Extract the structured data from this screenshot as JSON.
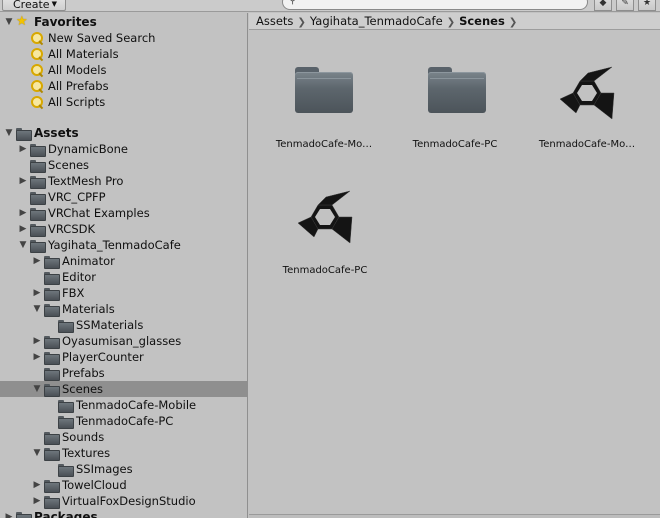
{
  "toolbar": {
    "create_label": "Create",
    "search_value": "",
    "icons": [
      "search-icon",
      "filter-by-type-icon",
      "filter-by-label-icon",
      "star-icon"
    ]
  },
  "favorites": {
    "label": "Favorites",
    "items": [
      {
        "label": "New Saved Search"
      },
      {
        "label": "All Materials"
      },
      {
        "label": "All Models"
      },
      {
        "label": "All Prefabs"
      },
      {
        "label": "All Scripts"
      }
    ]
  },
  "assets": {
    "label": "Assets",
    "items": [
      {
        "label": "DynamicBone"
      },
      {
        "label": "Scenes"
      },
      {
        "label": "TextMesh Pro"
      },
      {
        "label": "VRC_CPFP"
      },
      {
        "label": "VRChat Examples"
      },
      {
        "label": "VRCSDK"
      },
      {
        "label": "Yagihata_TenmadoCafe"
      },
      {
        "label": "Animator"
      },
      {
        "label": "Editor"
      },
      {
        "label": "FBX"
      },
      {
        "label": "Materials"
      },
      {
        "label": "SSMaterials"
      },
      {
        "label": "Oyasumisan_glasses"
      },
      {
        "label": "PlayerCounter"
      },
      {
        "label": "Prefabs"
      },
      {
        "label": "Scenes"
      },
      {
        "label": "TenmadoCafe-Mobile"
      },
      {
        "label": "TenmadoCafe-PC"
      },
      {
        "label": "Sounds"
      },
      {
        "label": "Textures"
      },
      {
        "label": "SSImages"
      },
      {
        "label": "TowelCloud"
      },
      {
        "label": "VirtualFoxDesignStudio"
      }
    ]
  },
  "packages": {
    "label": "Packages"
  },
  "breadcrumb": [
    "Assets",
    "Yagihata_TenmadoCafe",
    "Scenes"
  ],
  "grid": [
    {
      "label": "TenmadoCafe-Mo…",
      "kind": "folder"
    },
    {
      "label": "TenmadoCafe-PC",
      "kind": "folder"
    },
    {
      "label": "TenmadoCafe-Mo…",
      "kind": "scene"
    },
    {
      "label": "TenmadoCafe-PC",
      "kind": "scene"
    }
  ],
  "colors": {
    "panel": "#c2c2c2",
    "selection": "#8f8f8f",
    "folder": "#5d666d",
    "favorite_star": "#f2c200"
  }
}
